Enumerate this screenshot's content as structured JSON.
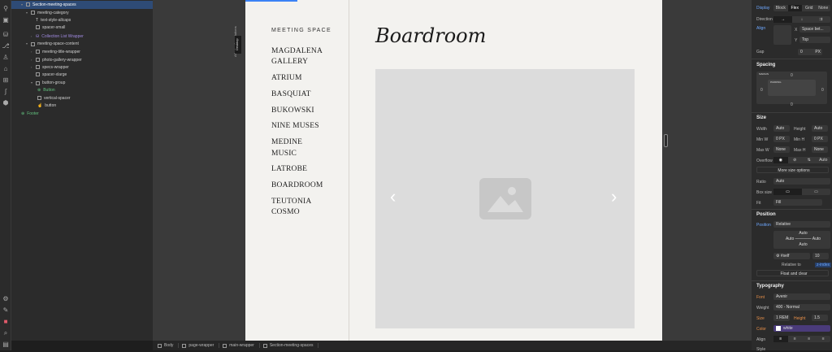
{
  "navigator": {
    "items": [
      {
        "label": "Section-meeting-spaces",
        "depth": 1,
        "selected": true
      },
      {
        "label": "meeting-category",
        "depth": 2
      },
      {
        "label": "text-style-allcaps",
        "depth": 3
      },
      {
        "label": "spacer-small",
        "depth": 3
      },
      {
        "label": "Collection List Wrapper",
        "depth": 3
      },
      {
        "label": "meeting-space-content",
        "depth": 2
      },
      {
        "label": "meeting-title-wrapper",
        "depth": 3
      },
      {
        "label": "photo-gallery-wrapper",
        "depth": 3
      },
      {
        "label": "specs-wrapper",
        "depth": 3
      },
      {
        "label": "spacer-xlarge",
        "depth": 3
      },
      {
        "label": "button-group",
        "depth": 3
      },
      {
        "label": "Button",
        "depth": 4
      },
      {
        "label": "vertical-spacer",
        "depth": 4
      },
      {
        "label": "button",
        "depth": 4
      },
      {
        "label": "Footer",
        "depth": 1
      }
    ]
  },
  "canvas": {
    "breakpoint_note": "Affects all resolutions",
    "breakpoint": "Desktop"
  },
  "page": {
    "category": "MEETING SPACE",
    "spaces": [
      "MAGDALENA GALLERY",
      "ATRIUM",
      "BASQUIAT",
      "BUKOWSKI",
      "NINE MUSES",
      "MEDINE MUSIC",
      "LATROBE",
      "BOARDROOM",
      "TEUTONIA COSMO"
    ],
    "title": "Boardroom",
    "prev": "‹",
    "next": "›"
  },
  "breadcrumbs": [
    "Body",
    "page-wrapper",
    "main-wrapper",
    "Section-meeting-spaces"
  ],
  "panel": {
    "display_label": "Display",
    "display_options": [
      "Block",
      "Flex",
      "Grid",
      "None"
    ],
    "direction_label": "Direction",
    "align_label": "Align",
    "x_label": "X",
    "x_value": "Space bet...",
    "y_label": "Y",
    "y_value": "Top",
    "gap_label": "Gap",
    "gap_value": "0",
    "gap_unit": "PX",
    "spacing_title": "Spacing",
    "margin_label": "MARGIN",
    "padding_label": "PADDING",
    "zero": "0",
    "size_title": "Size",
    "width_label": "Width",
    "width_value": "Auto",
    "height_label": "Height",
    "height_value": "Auto",
    "minw_label": "Min W",
    "minw_value": "0",
    "minh_label": "Min H",
    "minh_value": "0",
    "unit_px": "PX",
    "maxw_label": "Max W",
    "maxw_value": "None",
    "maxh_label": "Max H",
    "maxh_value": "None",
    "overflow_label": "Overflow",
    "overflow_auto": "Auto",
    "more_size": "More size options",
    "ratio_label": "Ratio",
    "ratio_value": "Auto",
    "boxsize_label": "Box size",
    "fit_label": "Fit",
    "fit_value": "Fill",
    "position_title": "Position",
    "position_label": "Position",
    "position_value": "Relative",
    "auto": "Auto",
    "self": "#self",
    "zindex_value": "10",
    "relative_to": "Relative to",
    "zindex_label": "z-index",
    "float_clear": "Float and clear",
    "typography_title": "Typography",
    "font_label": "Font",
    "font_value": "Avenir",
    "weight_label": "Weight",
    "weight_value": "400 - Normal",
    "size_label": "Size",
    "size_value": "1",
    "size_unit": "REM",
    "lh_label": "Height",
    "lh_value": "1.5",
    "color_label": "Color",
    "color_value": "white",
    "talign_label": "Align",
    "style_label": "Style"
  }
}
